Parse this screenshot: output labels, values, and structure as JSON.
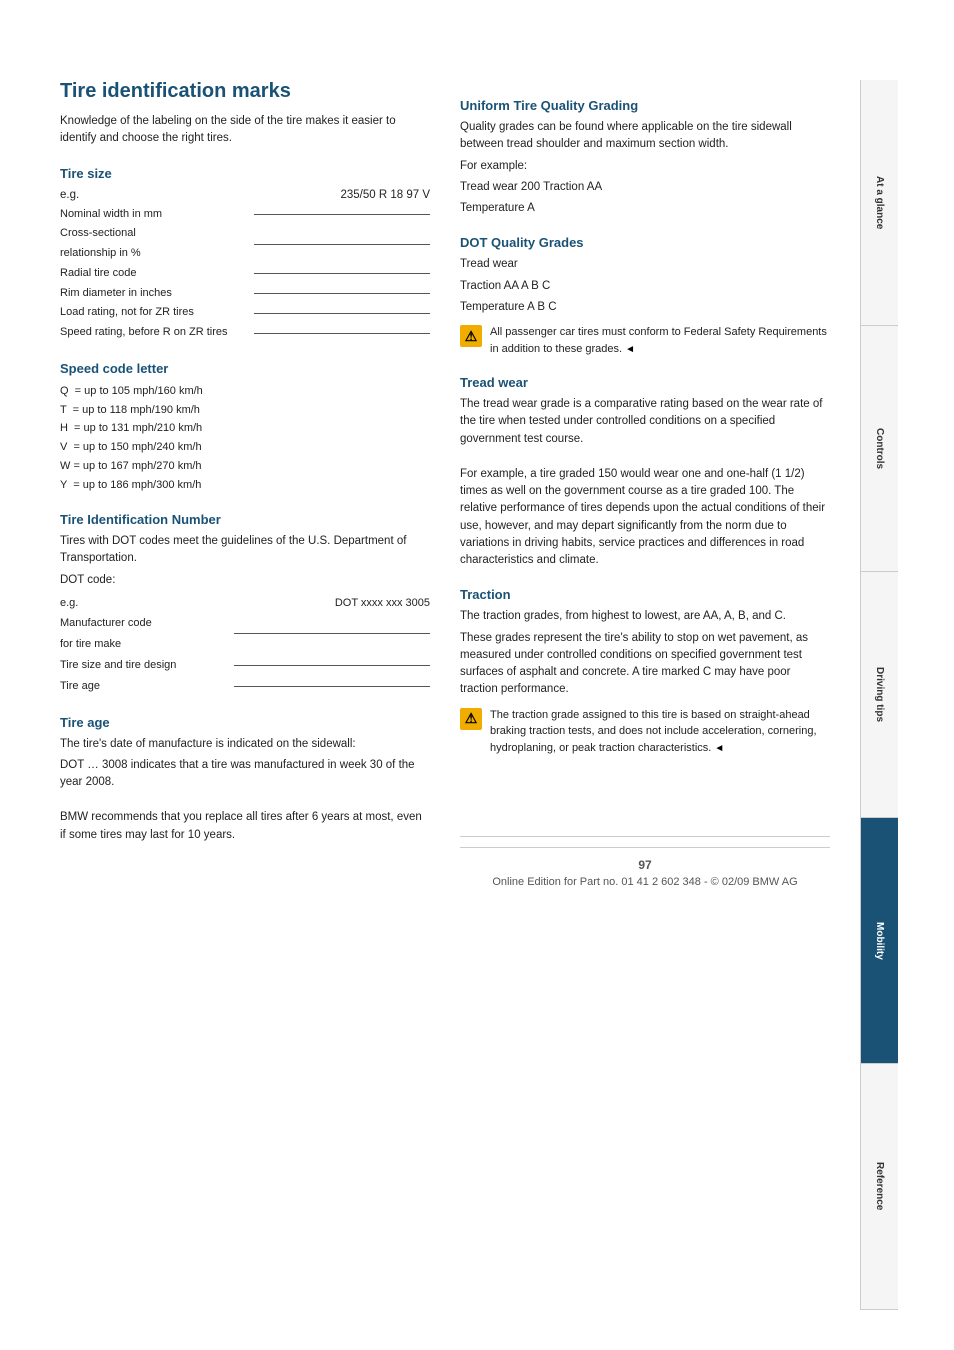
{
  "page": {
    "title": "Tire identification marks",
    "footer_page": "97",
    "footer_text": "Online Edition for Part no. 01 41 2 602 348 - © 02/09 BMW AG"
  },
  "left_col": {
    "intro_text": "Knowledge of the labeling on the side of the tire makes it easier to identify and choose the right tires.",
    "tire_size": {
      "title": "Tire size",
      "eg_label": "e.g.",
      "eg_value": "235/50 R 18 97 V",
      "rows": [
        "Nominal width in mm",
        "Cross-sectional relationship in %",
        "Radial tire code",
        "Rim diameter in inches",
        "Load rating, not for ZR tires",
        "Speed rating, before R on ZR tires"
      ]
    },
    "speed_code": {
      "title": "Speed code letter",
      "items": [
        "Q  = up to 105 mph/160 km/h",
        "T  = up to 118 mph/190 km/h",
        "H  = up to 131 mph/210 km/h",
        "V  = up to 150 mph/240 km/h",
        "W = up to 167 mph/270 km/h",
        "Y  = up to 186 mph/300 km/h"
      ]
    },
    "tire_id": {
      "title": "Tire Identification Number",
      "para1": "Tires with DOT codes meet the guidelines of the U.S. Department of Transportation.",
      "dot_label": "DOT code:",
      "eg_label": "e.g.",
      "eg_value": "DOT xxxx xxx 3005",
      "rows": [
        "Manufacturer code for tire make",
        "Tire size and tire design",
        "Tire age"
      ]
    },
    "tire_age": {
      "title": "Tire age",
      "para1": "The tire's date of manufacture is indicated on the sidewall:",
      "para2": "DOT … 3008 indicates that a tire was manufactured in week 30 of the year 2008.",
      "para3": "BMW recommends that you replace all tires after 6 years at most, even if some tires may last for 10 years."
    }
  },
  "right_col": {
    "utqg": {
      "title": "Uniform Tire Quality Grading",
      "para1": "Quality grades can be found where applicable on the tire sidewall between tread shoulder and maximum section width.",
      "para2": "For example:",
      "para3": "Tread wear 200 Traction AA",
      "para4": "Temperature A"
    },
    "dot_quality": {
      "title": "DOT Quality Grades",
      "line1": "Tread wear",
      "line2": "Traction AA A B C",
      "line3": "Temperature A B C",
      "warning": "All passenger car tires must conform to Federal Safety Requirements in addition to these grades."
    },
    "tread_wear": {
      "title": "Tread wear",
      "para1": "The tread wear grade is a comparative rating based on the wear rate of the tire when tested under controlled conditions on a specified government test course.",
      "para2": "For example, a tire graded 150 would wear one and one-half (1 1/2) times as well on the government course as a tire graded 100. The relative performance of tires depends upon the actual conditions of their use, however, and may depart significantly from the norm due to variations in driving habits, service practices and differences in road characteristics and climate."
    },
    "traction": {
      "title": "Traction",
      "para1": "The traction grades, from highest to lowest, are AA, A, B, and C.",
      "para2": "These grades represent the tire's ability to stop on wet pavement, as measured under controlled conditions on specified government test surfaces of asphalt and concrete. A tire marked C may have poor traction performance.",
      "warning": "The traction grade assigned to this tire is based on straight-ahead braking traction tests, and does not include acceleration, cornering, hydroplaning, or peak traction characteristics."
    }
  },
  "sidebar": {
    "tabs": [
      {
        "label": "At a glance",
        "active": false
      },
      {
        "label": "Controls",
        "active": false
      },
      {
        "label": "Driving tips",
        "active": false
      },
      {
        "label": "Mobility",
        "active": true
      },
      {
        "label": "Reference",
        "active": false
      }
    ]
  }
}
